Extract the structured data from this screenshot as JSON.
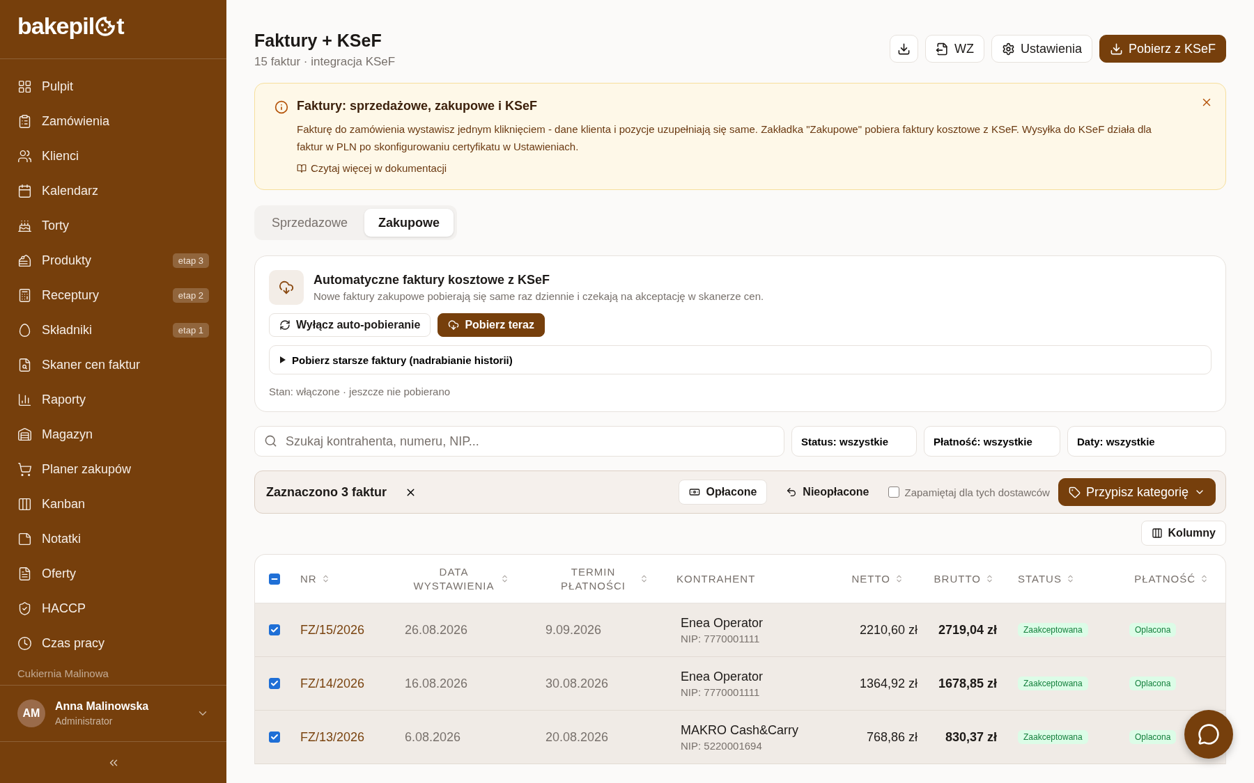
{
  "brand": {
    "logo_start": "bakepil",
    "logo_end": "t"
  },
  "sidebar": {
    "items": [
      {
        "label": "Pulpit"
      },
      {
        "label": "Zamówienia"
      },
      {
        "label": "Klienci"
      },
      {
        "label": "Kalendarz"
      },
      {
        "label": "Torty"
      },
      {
        "label": "Produkty",
        "badge": "etap 3"
      },
      {
        "label": "Receptury",
        "badge": "etap 2"
      },
      {
        "label": "Składniki",
        "badge": "etap 1"
      },
      {
        "label": "Skaner cen faktur"
      },
      {
        "label": "Raporty"
      },
      {
        "label": "Magazyn"
      },
      {
        "label": "Planer zakupów"
      },
      {
        "label": "Kanban"
      },
      {
        "label": "Notatki"
      },
      {
        "label": "Oferty"
      },
      {
        "label": "HACCP"
      },
      {
        "label": "Czas pracy"
      }
    ],
    "workspace": "Cukiernia Malinowa",
    "user": {
      "initials": "AM",
      "name": "Anna Malinowska",
      "role": "Administrator"
    }
  },
  "header": {
    "title": "Faktury + KSeF",
    "subtitle": "15 faktur · integracja KSeF",
    "buttons": [
      {
        "kind": "download"
      },
      {
        "kind": "file",
        "label": "WZ"
      },
      {
        "kind": "settings",
        "label": "Ustawienia"
      },
      {
        "kind": "primary",
        "label": "Pobierz z KSeF"
      }
    ]
  },
  "banner": {
    "title": "Faktury: sprzedażowe, zakupowe i KSeF",
    "text": "Fakturę do zamówienia wystawisz jednym kliknięciem - dane klienta i pozycje uzupełniają się same. Zakładka \"Zakupowe\" pobiera faktury kosztowe z KSeF. Wysyłka do KSeF działa dla faktur w PLN po skonfigurowaniu certyfikatu w Ustawieniach.",
    "link": "Czytaj więcej w dokumentacji"
  },
  "tabs": [
    {
      "label": "Sprzedazowe",
      "selected": false
    },
    {
      "label": "Zakupowe",
      "selected": true
    }
  ],
  "auto_card": {
    "title": "Automatyczne faktury kosztowe z KSeF",
    "description": "Nowe faktury zakupowe pobierają się same raz dziennie i czekają na akceptację w skanerze cen.",
    "buttons": [
      {
        "kind": "outline",
        "label": "Wyłącz auto-pobieranie"
      },
      {
        "kind": "primary",
        "label": "Pobierz teraz"
      }
    ],
    "details": {
      "label": "Pobierz starsze faktury (nadrabianie historii)",
      "expanded": false
    },
    "status": "Stan: włączone · jeszcze nie pobierano"
  },
  "filters": {
    "search": {
      "placeholder": "Szukaj kontrahenta, numeru, NIP..."
    },
    "dropdowns": [
      "Status: wszystkie",
      "Płatność: wszystkie",
      "Daty: wszystkie"
    ]
  },
  "selection": {
    "count": "Zaznaczono 3 faktur",
    "actions": [
      {
        "kind": "outline",
        "label": "Opłacone"
      },
      {
        "kind": "ghost",
        "label": "Nieopłacone"
      }
    ],
    "remember": {
      "label": "Zapamiętaj dla tych dostawców",
      "checked": false
    },
    "assign": "Przypisz kategorię"
  },
  "columns_button": "Kolumny",
  "table": {
    "select_all_indeterminate": true,
    "columns": [
      {
        "label": "NR",
        "sortable": true
      },
      {
        "label": "DATA WYSTAWIENIA",
        "sortable": true
      },
      {
        "label": "TERMIN PŁATNOŚCI",
        "sortable": true
      },
      {
        "label": "KONTRAHENT",
        "sortable": false
      },
      {
        "label": "NETTO",
        "sortable": true
      },
      {
        "label": "BRUTTO",
        "sortable": true
      },
      {
        "label": "STATUS",
        "sortable": true
      },
      {
        "label": "PŁATNOŚĆ",
        "sortable": true
      }
    ],
    "rows": [
      {
        "checked": true,
        "nr": "FZ/15/2026",
        "issued": "26.08.2026",
        "due": "9.09.2026",
        "contractor": "Enea Operator",
        "nip": "NIP: 7770001111",
        "net": "2210,60 zł",
        "gross": "2719,04 zł",
        "status": "Zaakceptowana",
        "payment": "Oplacona"
      },
      {
        "checked": true,
        "nr": "FZ/14/2026",
        "issued": "16.08.2026",
        "due": "30.08.2026",
        "contractor": "Enea Operator",
        "nip": "NIP: 7770001111",
        "net": "1364,92 zł",
        "gross": "1678,85 zł",
        "status": "Zaakceptowana",
        "payment": "Oplacona"
      },
      {
        "checked": true,
        "nr": "FZ/13/2026",
        "issued": "6.08.2026",
        "due": "20.08.2026",
        "contractor": "MAKRO Cash&Carry",
        "nip": "NIP: 5220001694",
        "net": "768,86 zł",
        "gross": "830,37 zł",
        "status": "Zaakceptowana",
        "payment": "Oplacona"
      }
    ]
  }
}
